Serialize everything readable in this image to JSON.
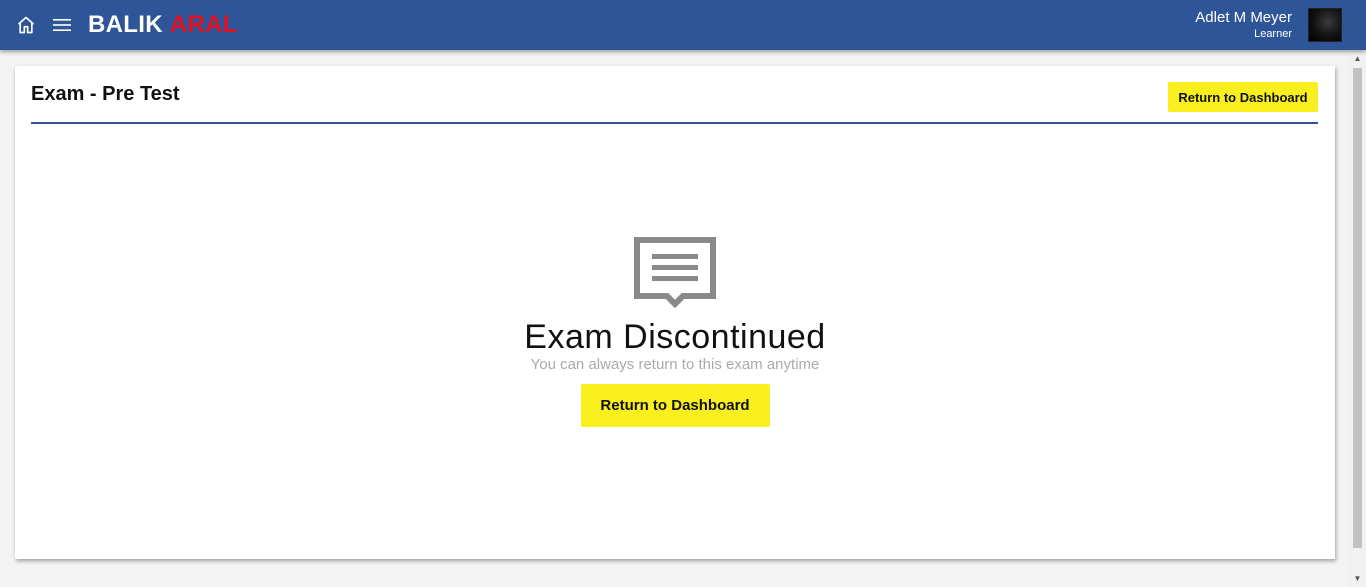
{
  "navbar": {
    "brand_part1": "BALIK",
    "brand_part2": "ARAL",
    "user_name": "Adlet M Meyer",
    "user_role": "Learner",
    "bg_color": "#2e5597",
    "brand_accent_color": "#e8101e"
  },
  "icons": {
    "home": "home-icon",
    "menu": "hamburger-menu-icon",
    "status": "message-icon"
  },
  "card": {
    "title": "Exam - Pre Test",
    "top_button_label": "Return to Dashboard"
  },
  "status": {
    "title": "Exam Discontinued",
    "subtitle": "You can always return to this exam anytime",
    "button_label": "Return to Dashboard",
    "button_color": "#f9ef1f"
  },
  "scrollbar": {
    "up_glyph": "▲",
    "down_glyph": "▼"
  }
}
